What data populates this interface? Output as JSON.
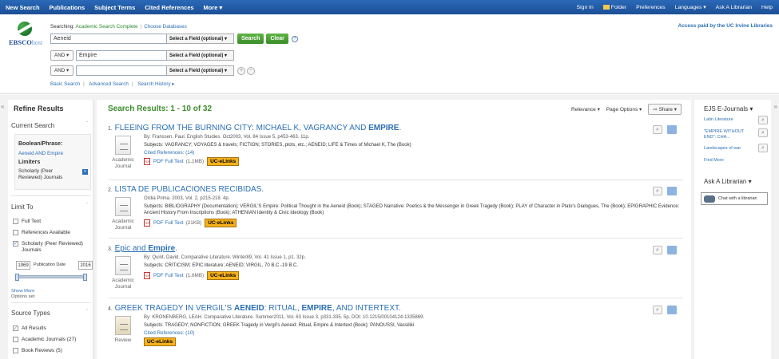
{
  "topbar": {
    "left": [
      "New Search",
      "Publications",
      "Subject Terms",
      "Cited References",
      "More ▾"
    ],
    "right": [
      "Sign In",
      "Folder",
      "Preferences",
      "Languages ▾",
      "Ask A Librarian",
      "Help"
    ]
  },
  "header": {
    "logo": "EBSCO",
    "logo_host": "host",
    "searching_label": "Searching:",
    "database": "Academic Search Complete",
    "choose": "Choose Databases",
    "q1": "Aeneid",
    "q2": "Empire",
    "q3": "",
    "field_placeholder": "Select a Field (optional) ▾",
    "op": "AND ▾",
    "search_btn": "Search",
    "clear_btn": "Clear",
    "help": "?",
    "plus": "+",
    "minus": "−",
    "links": [
      "Basic Search",
      "Advanced Search",
      "Search History ▸"
    ],
    "access": "Access paid by the UC Irvine Libraries"
  },
  "left": {
    "refine": "Refine Results",
    "current_search": "Current Search",
    "boolean_label": "Boolean/Phrase:",
    "boolean_value": "Aeneid AND Empire",
    "limiters_label": "Limiters",
    "limiter_value": "Scholarly (Peer Reviewed) Journals",
    "limit_to": "Limit To",
    "limits": [
      "Full Text",
      "References Available",
      "Scholarly (Peer Reviewed) Journals"
    ],
    "year_from": "1969",
    "year_label": "Publication Date",
    "year_to": "2016",
    "show_more": "Show More",
    "options_set": "Options set",
    "source_types": "Source Types",
    "sources": [
      "All Results",
      "Academic Journals (27)",
      "Book Reviews (5)"
    ]
  },
  "results": {
    "header": "Search Results: 1 - 10 of 32",
    "relevance": "Relevance ▾",
    "page_options": "Page Options ▾",
    "share": "Share ▾",
    "items": [
      {
        "num": "1.",
        "title_parts": [
          "FLEEING FROM THE BURNING CITY: MICHAEL K, VAGRANCY AND ",
          "EMPIRE",
          "."
        ],
        "meta": "By: Franssen, Paul. English Studies. Oct2003, Vol. 84 Issue 5, p453-463. 11p.",
        "subjects": "Subjects: VAGRANCY; VOYAGES & travels; FICTION; STORIES, plots, etc.; AENEID; LIFE & Times of Michael K, The (Book)",
        "cited": "Cited References: (14)",
        "pdf": "PDF Full Text",
        "size": "(1.1MB)",
        "uc": "UC-eLinks",
        "type": "Academic Journal"
      },
      {
        "num": "2.",
        "title_parts": [
          "LISTA DE PUBLICACIONES RECIBIDAS.",
          "",
          ""
        ],
        "meta": "Ordia Prima. 2003, Vol. 2, p215-218. 4p.",
        "subjects": "Subjects: BIBLIOGRAPHY (Documentation); VERGIL'S Empire: Political Thought in the Aeneid (Book); STAGED Narrative: Poetics & the Messenger in Greek Tragedy (Book); PLAY of Character in Plato's Dialogues, The (Book); EPIGRAPHIC Evidence: Ancient History From Inscriptions (Book); ATHENIAN Identity & Civic Ideology (Book)",
        "cited": "",
        "pdf": "PDF Full Text",
        "size": "(21KB)",
        "uc": "UC-eLinks",
        "type": "Academic Journal"
      },
      {
        "num": "3.",
        "title_parts": [
          "Epic and ",
          "Empire",
          "."
        ],
        "meta": "By: Quint, David. Comparative Literature. Winter89, Vol. 41 Issue 1, p1. 32p.",
        "subjects": "Subjects: CRITICISM; EPIC literature; AENEID; VIRGIL, 70 B.C.-19 B.C.",
        "cited": "",
        "pdf": "PDF Full Text",
        "size": "(1.6MB)",
        "uc": "UC-eLinks",
        "type": "Academic Journal"
      },
      {
        "num": "4.",
        "title_parts": [
          "GREEK TRAGEDY IN VERGIL'S ",
          "AENEID",
          ": RITUAL, ",
          "EMPIRE",
          ", AND INTERTEXT."
        ],
        "meta": "By: KRONENBERG, LEAH. Comparative Literature. Summer2011, Vol. 63 Issue 3, p331-335. 5p. DOI: 10.1215/00104124-1335869.",
        "subjects": "Subjects: TRAGEDY; NONFICTION; GREEK Tragedy in Vergil's Aeneid: Ritual, Empire & Intertext (Book); PANOUSSI, Vassiliki",
        "cited": "Cited References: (10)",
        "pdf": "",
        "size": "",
        "uc": "UC-eLinks",
        "type": "Review"
      }
    ]
  },
  "right": {
    "ejs": "EJS E-Journals ▾",
    "journals": [
      "Latin Literature",
      "\"EMPIRE WITHOUT END\": CHA...",
      "Landscapes of war"
    ],
    "find_more": "Find More",
    "ask": "Ask A Librarian ▾",
    "chat": "Chat with a librarian"
  },
  "colors": {
    "topbar": "#1c4f95",
    "link": "#2a6fb5",
    "green": "#3b8c2b",
    "uc": "#f6b21b"
  }
}
